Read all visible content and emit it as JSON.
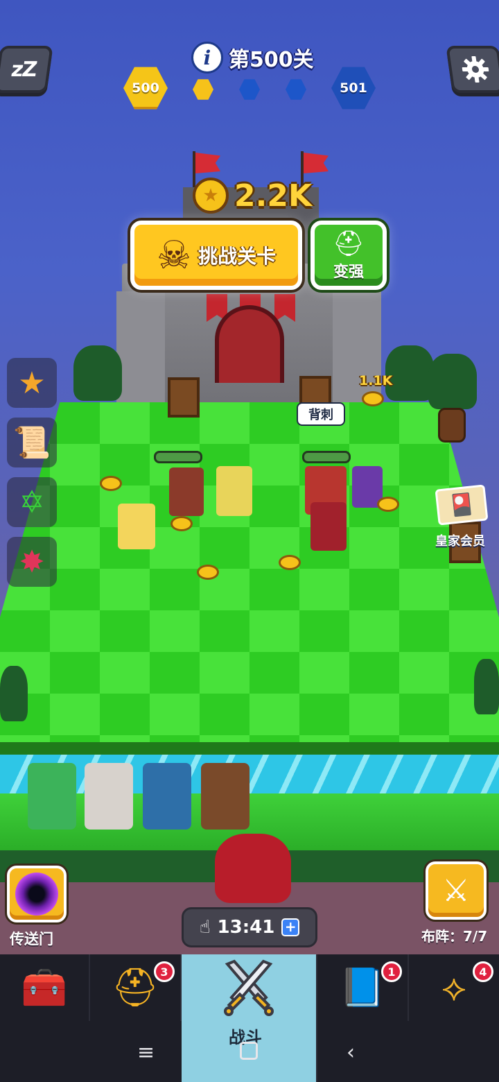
{
  "header": {
    "level_label": "第500关",
    "current_level": "500",
    "next_level": "501",
    "info_icon": "info-icon",
    "sleep_icon": "zzz-icon",
    "settings_icon": "gear-icon"
  },
  "castle": {
    "gold": "2.2K",
    "challenge_label": "挑战关卡",
    "power_up_label": "变强"
  },
  "board": {
    "skill_tag": "背刺",
    "coin_popup": "1.1K",
    "vip_label": "皇家会员"
  },
  "bottom": {
    "portal_label": "传送门",
    "timer": "13:41",
    "formation_label": "布阵：",
    "formation_count": "7/7"
  },
  "nav": {
    "tabs": [
      {
        "name": "chest",
        "icon": "treasure-chest-icon",
        "badge": ""
      },
      {
        "name": "heroes",
        "icon": "winged-helmet-icon",
        "badge": "3"
      },
      {
        "name": "battle",
        "icon": "crossed-swords-icon",
        "label": "战斗",
        "badge": ""
      },
      {
        "name": "spellbook",
        "icon": "spellbook-icon",
        "badge": "1"
      },
      {
        "name": "amulet",
        "icon": "amulet-icon",
        "badge": "4"
      }
    ]
  },
  "system_nav": [
    "menu-icon",
    "home-icon",
    "back-icon"
  ],
  "colors": {
    "sky": "#4b62c9",
    "gold": "#ffd43b",
    "grass_light": "#48e23a",
    "grass_dark": "#2ecc23",
    "badge_red": "#e0213f"
  }
}
